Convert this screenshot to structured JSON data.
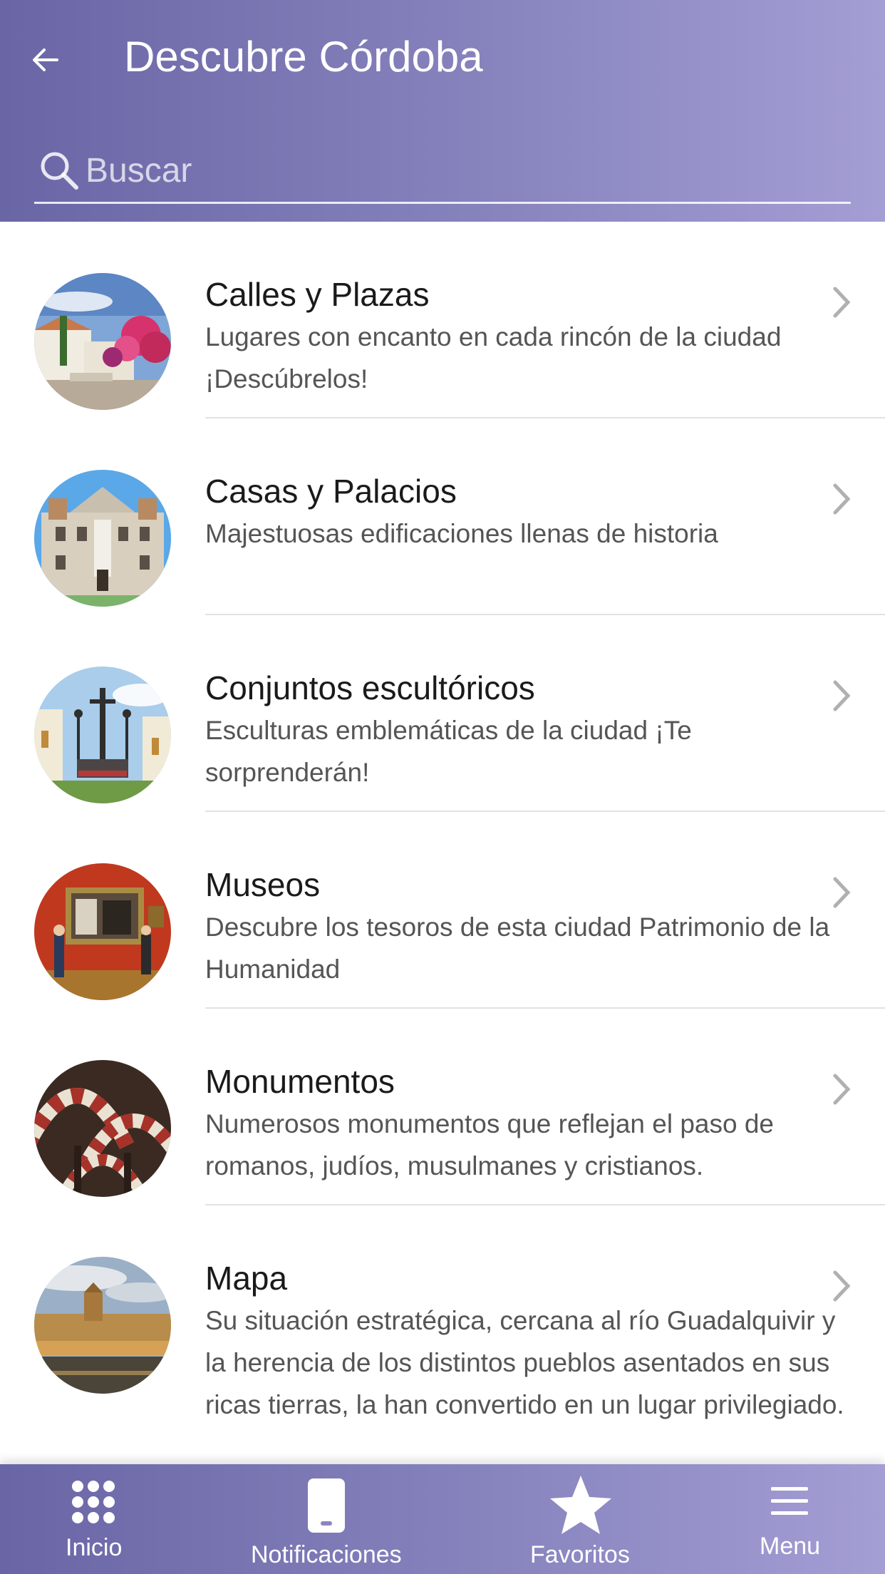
{
  "header": {
    "title": "Descubre Córdoba",
    "search_placeholder": "Buscar"
  },
  "colors": {
    "header_gradient_start": "#6a66a6",
    "header_gradient_end": "#a39ed4",
    "title_text": "#ffffff",
    "item_title": "#1a1a1a",
    "item_description": "#555555",
    "divider": "#e2e2e2",
    "chevron": "#b0b0b0"
  },
  "items": [
    {
      "title": "Calles y Plazas",
      "description": " Lugares con encanto en cada rincón de la ciudad ¡Descúbrelos!",
      "icon": "street-photo"
    },
    {
      "title": "Casas y Palacios",
      "description": " Majestuosas edificaciones llenas de historia",
      "icon": "palace-photo"
    },
    {
      "title": "Conjuntos escultóricos",
      "description": " Esculturas emblemáticas de la ciudad ¡Te sorprenderán!",
      "icon": "sculpture-photo"
    },
    {
      "title": "Museos",
      "description": " Descubre los tesoros de esta ciudad Patrimonio de la Humanidad",
      "icon": "museum-photo"
    },
    {
      "title": "Monumentos",
      "description": " Numerosos monumentos que reflejan el paso de romanos, judíos, musulmanes y cristianos.",
      "icon": "mosque-arches-photo"
    },
    {
      "title": "Mapa",
      "description": " Su situación estratégica, cercana al río Guadalquivir y la herencia de los distintos pueblos asentados en sus ricas tierras, la han convertido en un lugar privilegiado.",
      "icon": "city-bridge-photo"
    }
  ],
  "tabbar": {
    "tabs": [
      {
        "label": "Inicio",
        "icon": "grid-dots-icon"
      },
      {
        "label": "Notificaciones",
        "icon": "phone-icon"
      },
      {
        "label": "Favoritos",
        "icon": "star-icon"
      },
      {
        "label": "Menu",
        "icon": "hamburger-icon"
      }
    ]
  }
}
